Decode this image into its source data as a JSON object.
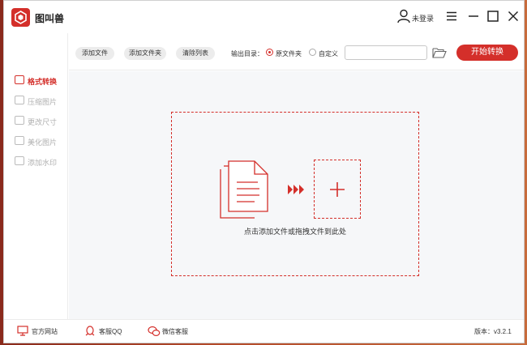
{
  "app": {
    "title": "图叫兽",
    "accent": "#d42f2a"
  },
  "header": {
    "user_label": "未登录"
  },
  "sidebar": {
    "items": [
      {
        "label": "格式转换",
        "icon": "swap-icon",
        "active": true
      },
      {
        "label": "压缩图片",
        "icon": "compress-icon",
        "active": false
      },
      {
        "label": "更改尺寸",
        "icon": "resize-icon",
        "active": false
      },
      {
        "label": "美化图片",
        "icon": "beautify-icon",
        "active": false
      },
      {
        "label": "添加水印",
        "icon": "watermark-icon",
        "active": false
      }
    ]
  },
  "toolbar": {
    "add_file": "添加文件",
    "add_folder": "添加文件夹",
    "clear_list": "清除列表",
    "output_label": "输出目录：",
    "option_original": "原文件夹",
    "option_custom": "自定义",
    "selected_option": "原文件夹",
    "path_value": "",
    "start": "开始转换"
  },
  "main": {
    "drop_hint": "点击添加文件或拖拽文件到此处"
  },
  "footer": {
    "website": "官方网站",
    "qq": "客服QQ",
    "wechat": "微信客服",
    "version": "版本：v3.2.1"
  }
}
